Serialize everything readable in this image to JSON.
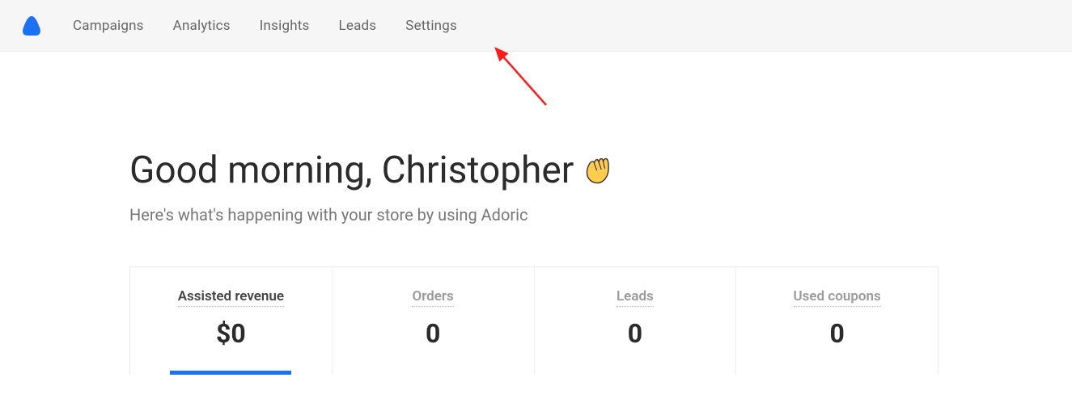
{
  "nav": {
    "items": [
      {
        "label": "Campaigns"
      },
      {
        "label": "Analytics"
      },
      {
        "label": "Insights"
      },
      {
        "label": "Leads"
      },
      {
        "label": "Settings"
      }
    ]
  },
  "greeting": {
    "text": "Good morning, Christopher"
  },
  "subtitle": "Here's what's happening with your store by using Adoric",
  "stats": {
    "items": [
      {
        "label": "Assisted revenue",
        "value": "$0",
        "active": true,
        "muted": false
      },
      {
        "label": "Orders",
        "value": "0",
        "active": false,
        "muted": true
      },
      {
        "label": "Leads",
        "value": "0",
        "active": false,
        "muted": true
      },
      {
        "label": "Used coupons",
        "value": "0",
        "active": false,
        "muted": true
      }
    ]
  },
  "colors": {
    "accent": "#1b71f2"
  }
}
